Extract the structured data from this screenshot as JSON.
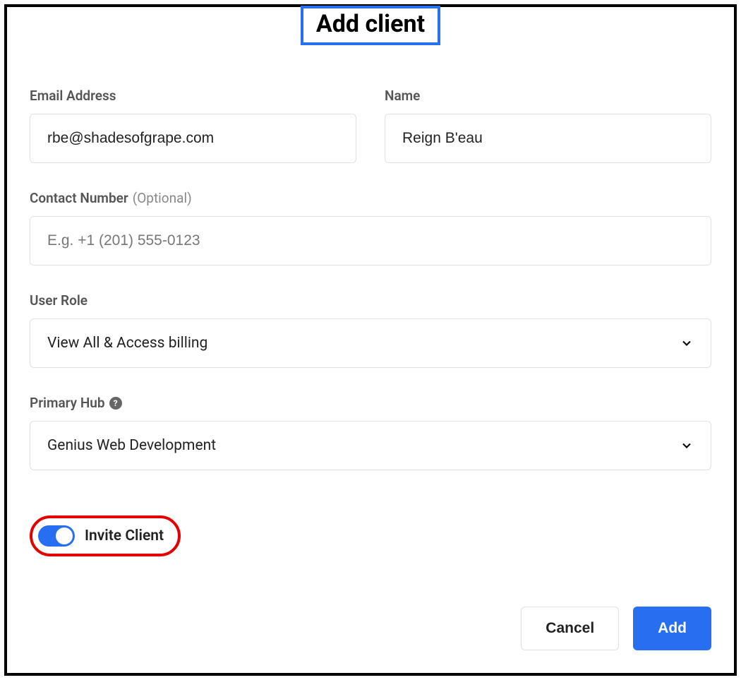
{
  "title": "Add client",
  "fields": {
    "email": {
      "label": "Email Address",
      "value": "rbe@shadesofgrape.com"
    },
    "name": {
      "label": "Name",
      "value": "Reign B'eau"
    },
    "contact": {
      "label": "Contact Number",
      "optional_text": "(Optional)",
      "placeholder": "E.g. +1 (201) 555-0123",
      "value": ""
    },
    "role": {
      "label": "User Role",
      "selected": "View All & Access billing"
    },
    "hub": {
      "label": "Primary Hub",
      "selected": "Genius Web Development"
    }
  },
  "toggle": {
    "label": "Invite Client",
    "on": true
  },
  "buttons": {
    "cancel": "Cancel",
    "add": "Add"
  },
  "icons": {
    "help": "?"
  }
}
